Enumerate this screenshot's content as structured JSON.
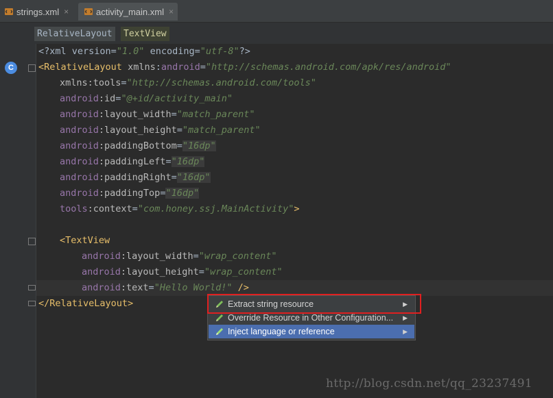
{
  "tabs": [
    {
      "label": "strings.xml",
      "close": "×",
      "active": false
    },
    {
      "label": "activity_main.xml",
      "close": "×",
      "active": true
    }
  ],
  "breadcrumb": [
    "RelativeLayout",
    "TextView"
  ],
  "badge": "C",
  "code": {
    "l1": {
      "p1": "<?xml version=",
      "v1": "\"1.0\"",
      "p2": " encoding=",
      "v2": "\"utf-8\"",
      "p3": "?>"
    },
    "l2": {
      "tag": "<RelativeLayout",
      "attr": "xmlns",
      "colon": ":",
      "ns": "android",
      "eq": "=",
      "val": "\"http://schemas.android.com/apk/res/android\""
    },
    "l3": {
      "attr": "xmlns:tools",
      "eq": "=",
      "val": "\"http://schemas.android.com/tools\""
    },
    "l4": {
      "ns": "android",
      "attr": ":id",
      "eq": "=",
      "val": "\"@+id/activity_main\""
    },
    "l5": {
      "ns": "android",
      "attr": ":layout_width",
      "eq": "=",
      "val": "\"match_parent\""
    },
    "l6": {
      "ns": "android",
      "attr": ":layout_height",
      "eq": "=",
      "val": "\"match_parent\""
    },
    "l7": {
      "ns": "android",
      "attr": ":paddingBottom",
      "eq": "=",
      "val": "\"16dp\""
    },
    "l8": {
      "ns": "android",
      "attr": ":paddingLeft",
      "eq": "=",
      "val": "\"16dp\""
    },
    "l9": {
      "ns": "android",
      "attr": ":paddingRight",
      "eq": "=",
      "val": "\"16dp\""
    },
    "l10": {
      "ns": "android",
      "attr": ":paddingTop",
      "eq": "=",
      "val": "\"16dp\""
    },
    "l11": {
      "ns": "tools",
      "attr": ":context",
      "eq": "=",
      "val": "\"com.honey.ssj.MainActivity\"",
      "end": ">"
    },
    "l13": {
      "tag": "<TextView"
    },
    "l14": {
      "ns": "android",
      "attr": ":layout_width",
      "eq": "=",
      "val": "\"wrap_content\""
    },
    "l15": {
      "ns": "android",
      "attr": ":layout_height",
      "eq": "=",
      "val": "\"wrap_content\""
    },
    "l16": {
      "ns": "android",
      "attr": ":text",
      "eq": "=",
      "val": "\"Hello World!\"",
      "end": " />"
    },
    "l17": {
      "tag": "</RelativeLayout>"
    }
  },
  "popup": {
    "items": [
      {
        "label": "Extract string resource",
        "arrow": "▶",
        "selected": false
      },
      {
        "label": "Override Resource in Other Configuration...",
        "arrow": "▶",
        "selected": false
      },
      {
        "label": "Inject language or reference",
        "arrow": "▶",
        "selected": true
      }
    ]
  },
  "watermark": "http://blog.csdn.net/qq_23237491",
  "colors": {
    "highlight_box": "#e02020",
    "selection": "#4b6eaf",
    "tag": "#e8bf6a",
    "value": "#6a8759",
    "namespace": "#9876aa"
  }
}
